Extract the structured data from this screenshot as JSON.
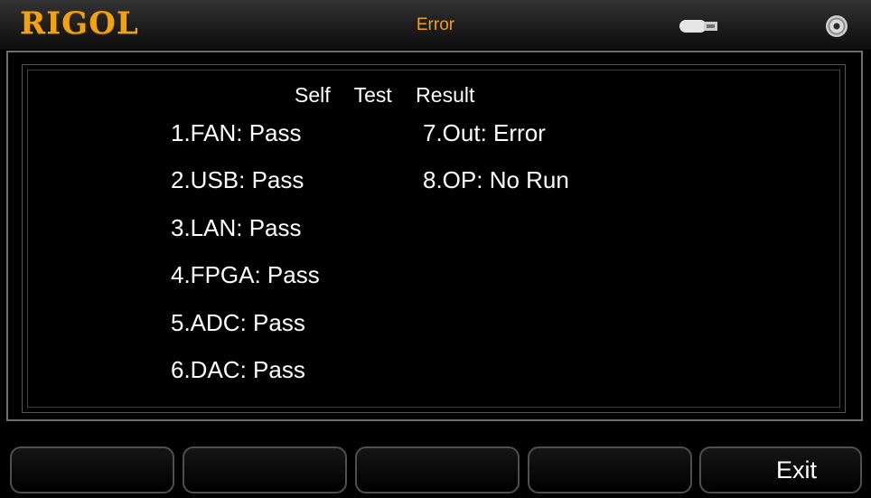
{
  "header": {
    "brand": "RIGOL",
    "title": "Error",
    "status_icons": [
      "usb-icon",
      "speaker-icon"
    ]
  },
  "self_test": {
    "heading": "Self Test Result",
    "results": [
      "1.FAN: Pass",
      "2.USB: Pass",
      "3.LAN: Pass",
      "4.FPGA: Pass",
      "5.ADC: Pass",
      "6.DAC: Pass",
      "7.Out: Error",
      "8.OP: No Run"
    ]
  },
  "softkeys": [
    "",
    "",
    "",
    "",
    "Exit"
  ],
  "colors": {
    "brand": "#f2a20c",
    "title": "#f2a20c",
    "text": "#ffffff",
    "background": "#000000"
  }
}
